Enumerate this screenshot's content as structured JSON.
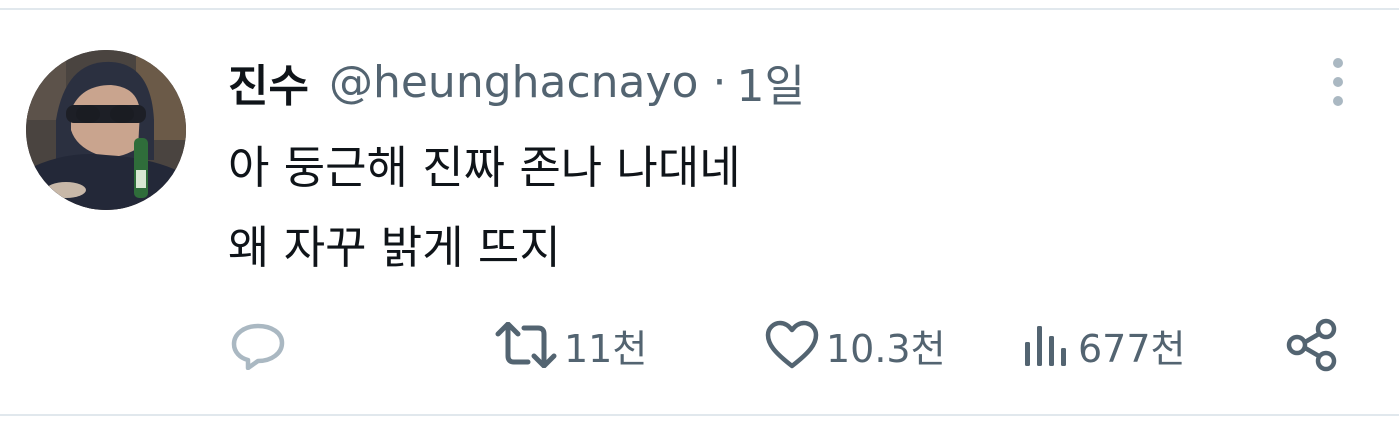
{
  "tweet": {
    "display_name": "진수",
    "handle": "@heunghacnayo",
    "separator": "·",
    "time": "1일",
    "text_lines": [
      "아 둥근해 진짜 존나 나대네",
      "왜 자꾸 밝게 뜨지"
    ]
  },
  "actions": {
    "reply": {
      "icon": "reply-icon",
      "count": ""
    },
    "retweet": {
      "icon": "retweet-icon",
      "count": "11천"
    },
    "like": {
      "icon": "heart-icon",
      "count": "10.3천"
    },
    "views": {
      "icon": "views-icon",
      "count": "677천"
    },
    "share": {
      "icon": "share-icon"
    }
  },
  "colors": {
    "text": "#0f1419",
    "secondary": "#536471",
    "divider": "#e1e8ed",
    "muted_icon": "#aab8c2"
  }
}
